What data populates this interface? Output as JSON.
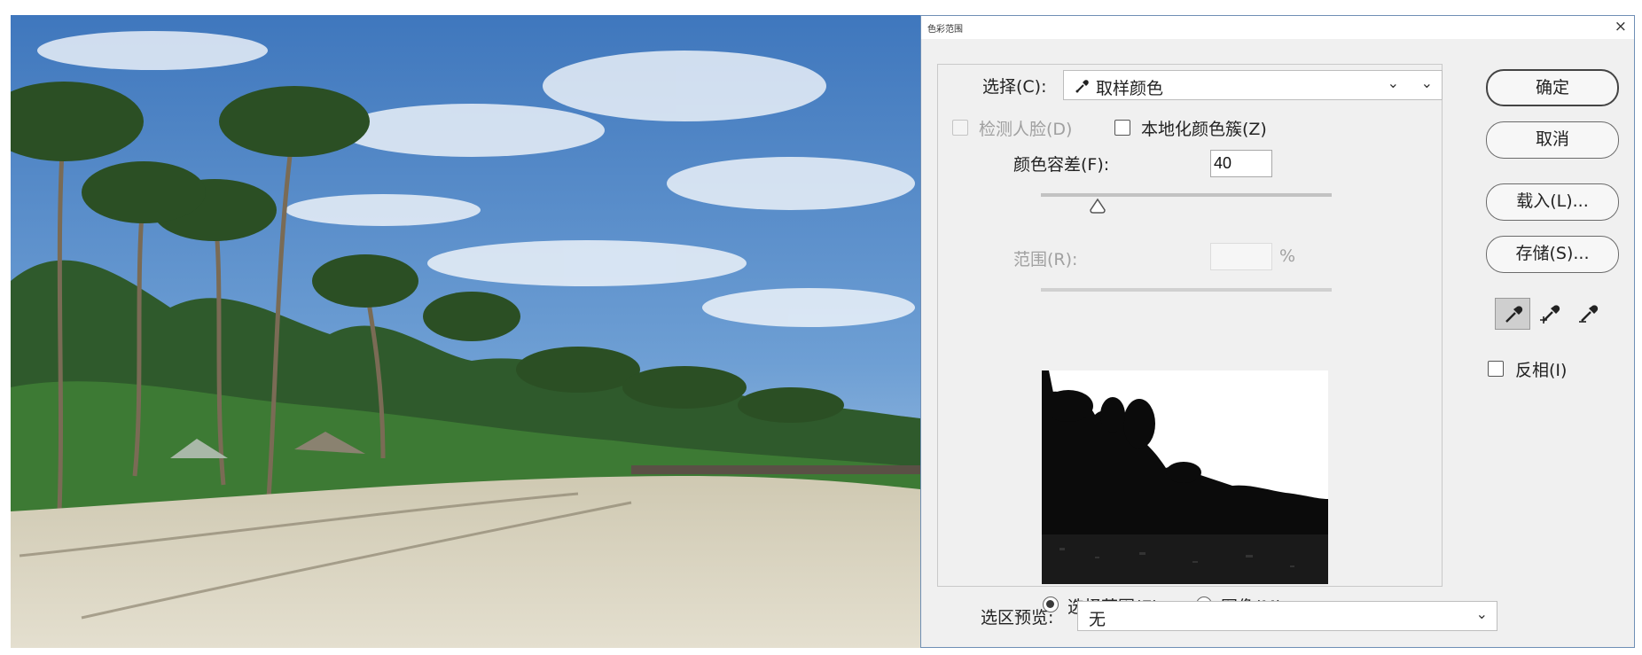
{
  "dialog": {
    "title": "色彩范围",
    "select_label": "选择(C):",
    "select_value": "取样颜色",
    "detect_faces_label": "检测人脸(D)",
    "localized_clusters_label": "本地化颜色簇(Z)",
    "fuzziness_label": "颜色容差(F):",
    "fuzziness_value": "40",
    "fuzziness_slider_fraction": 0.2,
    "range_label": "范围(R):",
    "range_value": "",
    "range_unit": "%",
    "selection_radio_label": "选择范围(E)",
    "image_radio_label": "图像(M)",
    "preview_label": "选区预览:",
    "preview_value": "无",
    "invert_label": "反相(I)"
  },
  "buttons": {
    "ok": "确定",
    "cancel": "取消",
    "load": "载入(L)...",
    "save": "存储(S)..."
  },
  "tools": [
    "eyedropper-icon",
    "eyedropper-plus-icon",
    "eyedropper-minus-icon"
  ],
  "colors": {
    "dialog_bg": "#f0f0f0",
    "sky": "#4f86c6",
    "sand": "#dcd6c3"
  }
}
